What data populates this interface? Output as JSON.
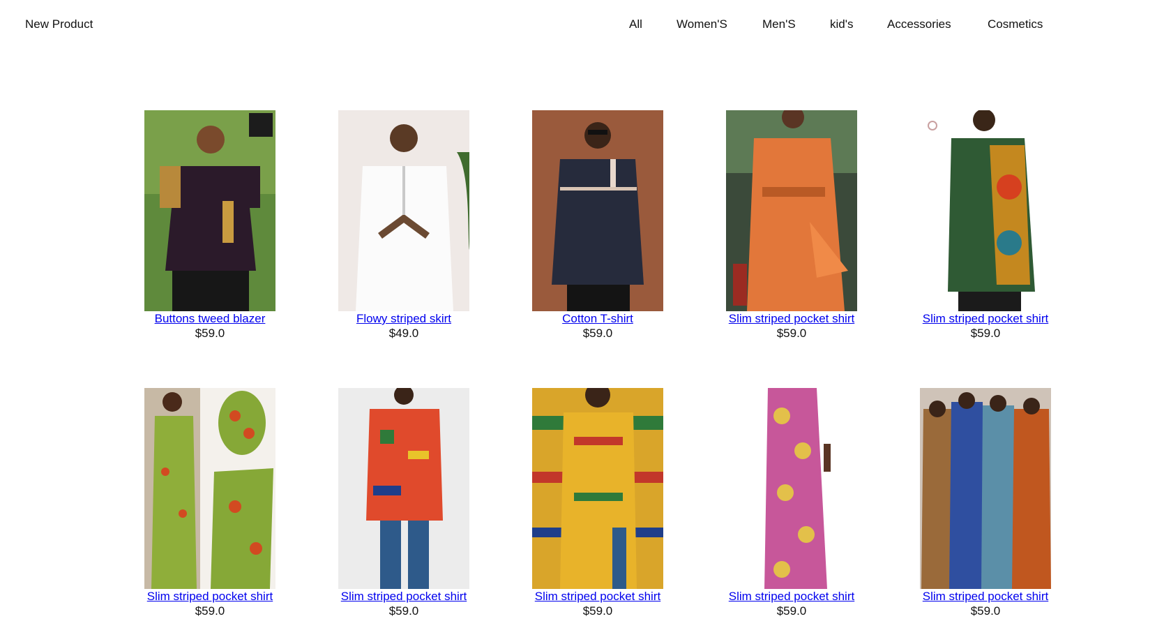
{
  "header": {
    "brand": "New Product",
    "nav": [
      {
        "label": "All"
      },
      {
        "label": "Women'S"
      },
      {
        "label": "Men'S"
      },
      {
        "label": "kid's"
      },
      {
        "label": "Accessories"
      },
      {
        "label": "Cosmetics"
      }
    ]
  },
  "products": [
    {
      "title": "Buttons tweed blazer",
      "price": "$59.0"
    },
    {
      "title": "Flowy striped skirt",
      "price": "$49.0"
    },
    {
      "title": "Cotton T-shirt",
      "price": "$59.0"
    },
    {
      "title": "Slim striped pocket shirt",
      "price": "$59.0"
    },
    {
      "title": "Slim striped pocket shirt",
      "price": "$59.0"
    },
    {
      "title": "Slim striped pocket shirt",
      "price": "$59.0"
    },
    {
      "title": "Slim striped pocket shirt",
      "price": "$59.0"
    },
    {
      "title": "Slim striped pocket shirt",
      "price": "$59.0"
    },
    {
      "title": "Slim striped pocket shirt",
      "price": "$59.0"
    },
    {
      "title": "Slim striped pocket shirt",
      "price": "$59.0"
    }
  ],
  "colors": {
    "link": "#0000ee",
    "text": "#111111",
    "background": "#ffffff"
  }
}
